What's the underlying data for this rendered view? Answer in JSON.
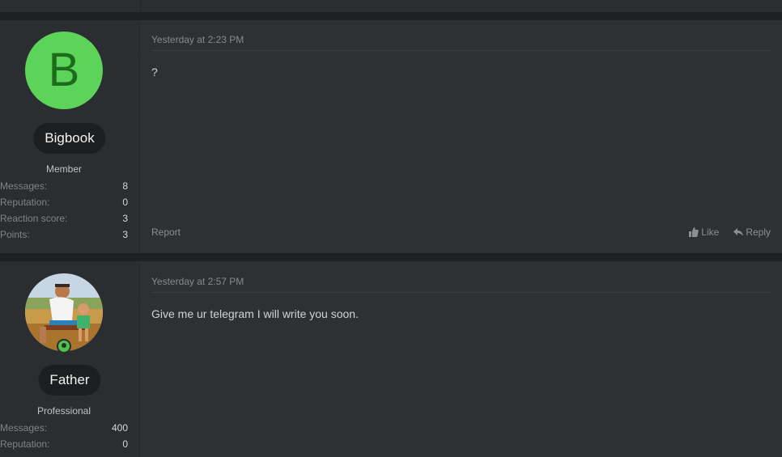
{
  "posts": [
    {
      "user": {
        "avatar_letter": "B",
        "avatar_color": "#5cd45a",
        "name": "Bigbook",
        "title": "Member",
        "stats": [
          {
            "label": "Messages:",
            "value": "8"
          },
          {
            "label": "Reputation:",
            "value": "0"
          },
          {
            "label": "Reaction score:",
            "value": "3"
          },
          {
            "label": "Points:",
            "value": "3"
          }
        ]
      },
      "date": "Yesterday at 2:23 PM",
      "message": "?",
      "report_label": "Report",
      "like_label": "Like",
      "reply_label": "Reply"
    },
    {
      "user": {
        "name": "Father",
        "title": "Professional",
        "online_icon": "online-status-icon",
        "stats": [
          {
            "label": "Messages:",
            "value": "400"
          },
          {
            "label": "Reputation:",
            "value": "0"
          }
        ]
      },
      "date": "Yesterday at 2:57 PM",
      "message": "Give me ur telegram I will write you soon."
    }
  ]
}
